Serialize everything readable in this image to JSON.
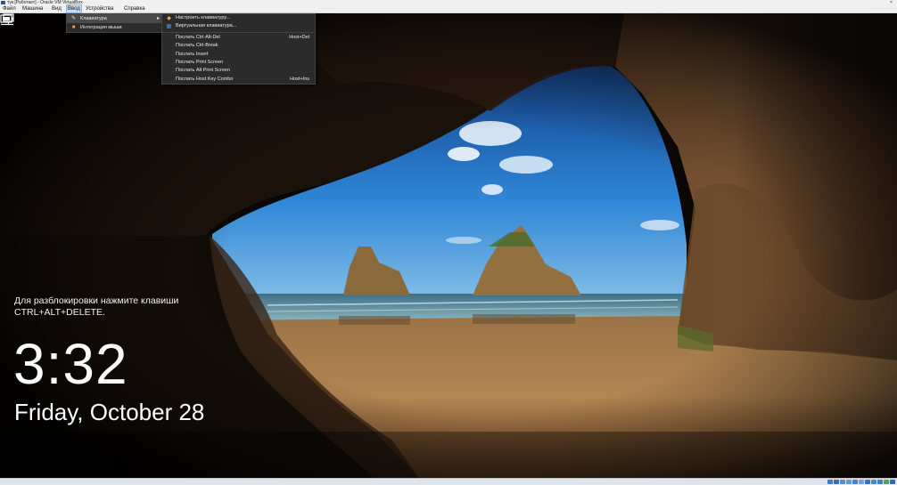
{
  "window": {
    "title": "тук [Работает] - Oracle VM VirtualBox",
    "close_glyph": "×"
  },
  "menubar": {
    "items": [
      {
        "label": "Файл"
      },
      {
        "label": "Машина"
      },
      {
        "label": "Вид"
      },
      {
        "label": "Ввод"
      },
      {
        "label": "Устройства"
      },
      {
        "label": "Справка"
      }
    ],
    "active": "Ввод"
  },
  "input_menu": {
    "items": [
      {
        "label": "Клавиатура",
        "icon": "keyboard-icon",
        "has_submenu": true,
        "highlighted": true
      },
      {
        "label": "Интеграция мыши",
        "icon": "mouse-icon",
        "has_submenu": false,
        "highlighted": false
      }
    ]
  },
  "keyboard_submenu": {
    "items": [
      {
        "label": "Настроить клавиатуру...",
        "icon": "settings-icon",
        "shortcut": ""
      },
      {
        "label": "Виртуальная клавиатура...",
        "icon": "virtual-keyboard-icon",
        "shortcut": ""
      },
      {
        "label": "Послать Ctrl-Alt-Del",
        "icon": "",
        "shortcut": "Host+Del"
      },
      {
        "label": "Послать Ctrl-Break",
        "icon": "",
        "shortcut": ""
      },
      {
        "label": "Послать Insert",
        "icon": "",
        "shortcut": ""
      },
      {
        "label": "Послать Print Screen",
        "icon": "",
        "shortcut": ""
      },
      {
        "label": "Послать Alt Print Screen",
        "icon": "",
        "shortcut": ""
      },
      {
        "label": "Послать Host Key Combo",
        "icon": "",
        "shortcut": "Host+Ins"
      }
    ]
  },
  "lockscreen": {
    "message_line1": "Для разблокировки нажмите клавиши",
    "message_line2": "CTRL+ALT+DELETE.",
    "time": "3:32",
    "date": "Friday, October 28",
    "icons": [
      "network-icon",
      "battery-icon"
    ]
  },
  "colors": {
    "menu_bg": "#2b2b2b",
    "menu_highlight": "#4a4a4a",
    "sky": "#1f6fc4",
    "sand": "#a77a45",
    "rock": "#2a1c12"
  }
}
